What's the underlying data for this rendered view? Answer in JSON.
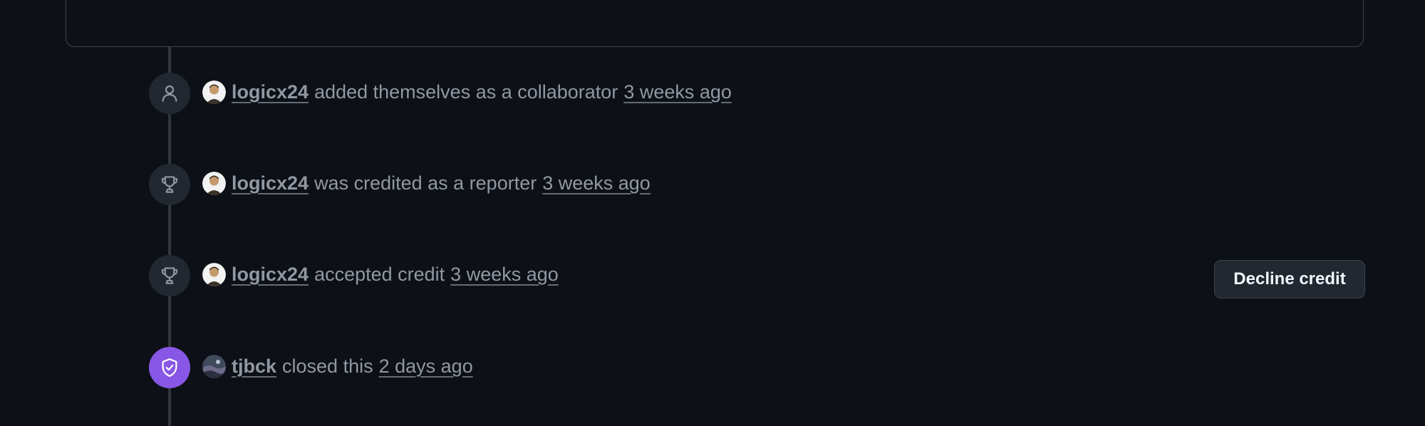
{
  "timeline": {
    "events": [
      {
        "icon": "person-icon",
        "user": "logicx24",
        "action": "added themselves as a collaborator",
        "time": "3 weeks ago"
      },
      {
        "icon": "trophy-icon",
        "user": "logicx24",
        "action": "was credited as a reporter",
        "time": "3 weeks ago"
      },
      {
        "icon": "trophy-icon",
        "user": "logicx24",
        "action": "accepted credit",
        "time": "3 weeks ago"
      },
      {
        "icon": "shield-check-icon",
        "user": "tjbck",
        "action": "closed this",
        "time": "2 days ago"
      }
    ]
  },
  "decline_button": {
    "label": "Decline credit"
  },
  "colors": {
    "background": "#0d1117",
    "badge": "#212830",
    "closed_badge": "#8957e5",
    "text": "#9198a1"
  }
}
